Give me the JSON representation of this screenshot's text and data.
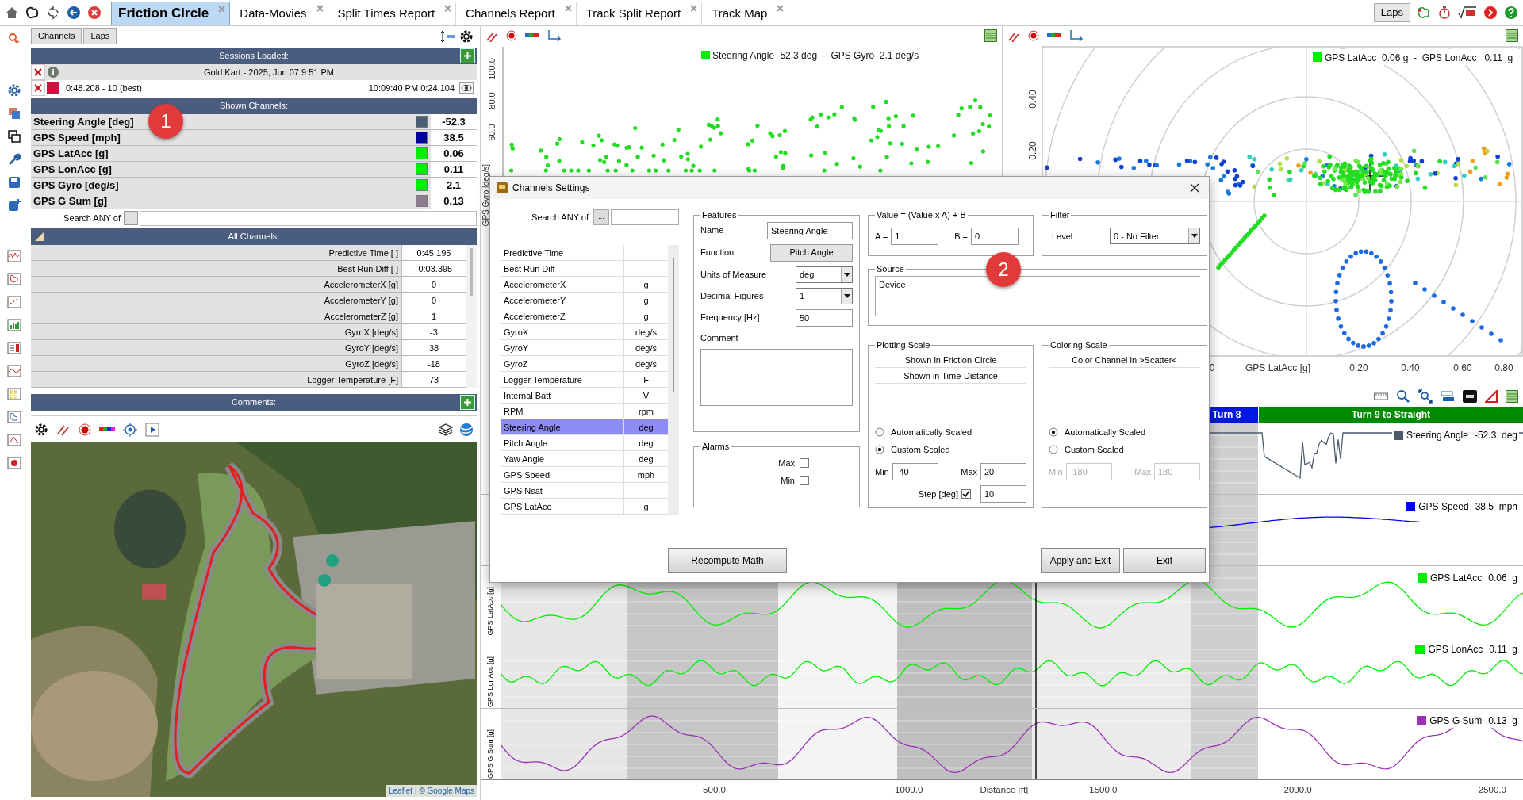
{
  "tabs": [
    {
      "label": "Friction Circle",
      "selected": true
    },
    {
      "label": "Data-Movies",
      "selected": false
    },
    {
      "label": "Split Times Report",
      "selected": false
    },
    {
      "label": "Channels Report",
      "selected": false
    },
    {
      "label": "Track Split Report",
      "selected": false
    },
    {
      "label": "Track Map",
      "selected": false
    }
  ],
  "top_right_button": "Laps",
  "left_panel": {
    "buttons": [
      "Channels",
      "Laps"
    ],
    "sessions_header": "Sessions Loaded:",
    "session": {
      "title": "Gold Kart - 2025, Jun 07 9:51 PM"
    },
    "lap": {
      "label": "0:48.208 - 10 (best)",
      "time": "10:09:40 PM 0:24.104",
      "color": "#d0103a"
    },
    "shown_header": "Shown Channels:",
    "shown_channels": [
      {
        "name": "Steering Angle [deg]",
        "color": "#4b5e78",
        "value": "-52.3"
      },
      {
        "name": "GPS Speed [mph]",
        "color": "#00009a",
        "value": "38.5"
      },
      {
        "name": "GPS LatAcc [g]",
        "color": "#00ee00",
        "value": "0.06"
      },
      {
        "name": "GPS LonAcc [g]",
        "color": "#00ee00",
        "value": "0.11"
      },
      {
        "name": "GPS Gyro [deg/s]",
        "color": "#00ee00",
        "value": "2.1"
      },
      {
        "name": "GPS G Sum [g]",
        "color": "#8e7d8e",
        "value": "0.13"
      }
    ],
    "search_label": "Search ANY of",
    "search_button": "...",
    "all_header": "All Channels:",
    "all_channels": [
      {
        "name": "Predictive Time [ ]",
        "value": "0:45.195"
      },
      {
        "name": "Best Run Diff [ ]",
        "value": "-0:03.395"
      },
      {
        "name": "AccelerometerX [g]",
        "value": "0"
      },
      {
        "name": "AccelerometerY [g]",
        "value": "0"
      },
      {
        "name": "AccelerometerZ [g]",
        "value": "1"
      },
      {
        "name": "GyroX [deg/s]",
        "value": "-3"
      },
      {
        "name": "GyroY [deg/s]",
        "value": "38"
      },
      {
        "name": "GyroZ [deg/s]",
        "value": "-18"
      },
      {
        "name": "Logger Temperature [F]",
        "value": "73"
      }
    ],
    "comments_header": "Comments:",
    "map": {
      "kind": "picture",
      "attribution_link": "Leaflet",
      "attribution": "| © Google Maps"
    }
  },
  "scatter_chart": {
    "legend": {
      "text": "Steering Angle -52.3 deg  -  GPS Gyro  2.1 deg/s",
      "color": "#00ee00"
    },
    "yticks": [
      "100.0",
      "80.0",
      "60.0"
    ],
    "ylabel": "GPS Gyro [deg/s]"
  },
  "friction_circle": {
    "legend": {
      "text": "GPS LatAcc  0.06 g  -  GPS LonAcc   0.11  g",
      "color": "#00ee00"
    },
    "yticks": [
      "0.40",
      "0.20"
    ],
    "xticks": [
      "0",
      "0.20",
      "0.40",
      "0.60",
      "0.80"
    ],
    "xlabel": "GPS LatAcc [g]"
  },
  "segments": [
    {
      "label": "Turn 8",
      "color": "#0018e0"
    },
    {
      "label": "Turn 9 to Straight",
      "color": "#008a00"
    }
  ],
  "strips": [
    {
      "name": "Steering Angle",
      "value": "-52.3  deg",
      "color": "#4b5b6b"
    },
    {
      "name": "GPS Speed",
      "value": "38.5  mph",
      "color": "#0000ee"
    },
    {
      "name": "GPS LatAcc",
      "value": "0.06  g",
      "color": "#00ee00",
      "axis_label": "GPS LatAcc [g]"
    },
    {
      "name": "GPS LonAcc",
      "value": "0.11  g",
      "color": "#00ee00",
      "axis_label": "GPS LonAcc [g]"
    },
    {
      "name": "GPS G Sum",
      "value": "0.13  g",
      "color": "#9b30b8",
      "axis_label": "GPS G Sum [g]"
    }
  ],
  "distance_axis": {
    "xticks": [
      "500.0",
      "1000.0",
      "1500.0",
      "2000.0",
      "2500.0"
    ],
    "xlabel": "Distance [ft]"
  },
  "dialog": {
    "title": "Channels Settings",
    "search_label": "Search ANY of",
    "search_button": "...",
    "channels": [
      {
        "name": "Predictive Time",
        "selected": false
      },
      {
        "name": "Best Run Diff",
        "selected": false
      },
      {
        "name": "AccelerometerX",
        "unit": "g",
        "selected": false
      },
      {
        "name": "AccelerometerY",
        "unit": "g",
        "selected": false
      },
      {
        "name": "AccelerometerZ",
        "unit": "g",
        "selected": false
      },
      {
        "name": "GyroX",
        "unit": "deg/s",
        "selected": false
      },
      {
        "name": "GyroY",
        "unit": "deg/s",
        "selected": false
      },
      {
        "name": "GyroZ",
        "unit": "deg/s",
        "selected": false
      },
      {
        "name": "Logger Temperature",
        "unit": "F",
        "selected": false
      },
      {
        "name": "Internal Batt",
        "unit": "V",
        "selected": false
      },
      {
        "name": "RPM",
        "unit": "rpm",
        "selected": false
      },
      {
        "name": "Steering Angle",
        "unit": "deg",
        "selected": true
      },
      {
        "name": "Pitch Angle",
        "unit": "deg",
        "selected": false
      },
      {
        "name": "Yaw Angle",
        "unit": "deg",
        "selected": false
      },
      {
        "name": "GPS Speed",
        "unit": "mph",
        "selected": false
      },
      {
        "name": "GPS Nsat",
        "selected": false
      },
      {
        "name": "GPS LatAcc",
        "unit": "g",
        "selected": false
      }
    ],
    "features": {
      "title": "Features",
      "name_label": "Name",
      "name_value": "Steering Angle",
      "function_label": "Function",
      "function_value": "Pitch Angle",
      "units_label": "Units of Measure",
      "units_value": "deg",
      "decimals_label": "Decimal Figures",
      "decimals_value": "1",
      "frequency_label": "Frequency [Hz]",
      "frequency_value": "50",
      "comment_label": "Comment"
    },
    "alarms": {
      "title": "Alarms",
      "items": [
        {
          "label": "Max",
          "checked": false
        },
        {
          "label": "Min",
          "checked": false
        }
      ]
    },
    "formula": {
      "title": "Value = (Value x A) + B",
      "a_label": "A =",
      "a_value": "1",
      "b_label": "B =",
      "b_value": "0"
    },
    "filter": {
      "title": "Filter",
      "level_label": "Level",
      "level_value": "0 - No Filter"
    },
    "source": {
      "title": "Source",
      "value": "Device"
    },
    "plotting_scale": {
      "title": "Plotting Scale",
      "lines": [
        "Shown in Friction Circle",
        "Shown in Time-Distance"
      ],
      "options": [
        {
          "label": "Automatically Scaled",
          "selected": false
        },
        {
          "label": "Custom Scaled",
          "selected": true
        }
      ],
      "min_label": "Min",
      "min_value": "-40",
      "max_label": "Max",
      "max_value": "20",
      "step_label": "Step [deg]",
      "step_checked": true,
      "step_value": "10"
    },
    "coloring_scale": {
      "title": "Coloring Scale",
      "lines": [
        "Color Channel in >Scatter<"
      ],
      "options": [
        {
          "label": "Automatically Scaled",
          "selected": true
        },
        {
          "label": "Custom Scaled",
          "selected": false
        }
      ],
      "min_label": "Min",
      "min_value": "-180",
      "max_label": "Max",
      "max_value": "180",
      "range_disabled": true
    },
    "buttons": {
      "recompute": "Recompute Math",
      "apply": "Apply and Exit",
      "exit": "Exit"
    }
  },
  "callouts": [
    "1",
    "2"
  ]
}
